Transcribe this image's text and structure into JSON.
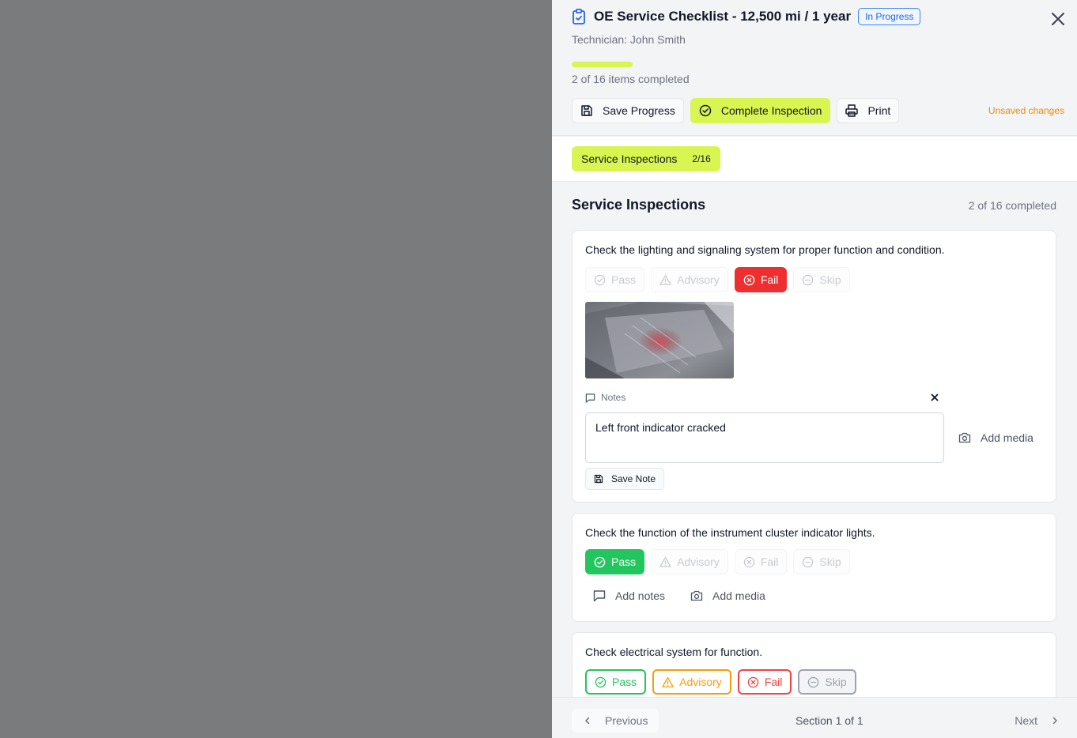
{
  "header": {
    "title": "OE Service Checklist - 12,500 mi / 1 year",
    "status_badge": "In Progress",
    "technician": "Technician: John Smith",
    "progress_text": "2 of 16 items completed",
    "progress_fraction": 0.125,
    "buttons": {
      "save": "Save Progress",
      "complete": "Complete Inspection",
      "print": "Print"
    },
    "unsaved": "Unsaved changes",
    "accent_color": "#d9f552"
  },
  "tabs": [
    {
      "label": "Service Inspections",
      "count": "2/16"
    }
  ],
  "section": {
    "title": "Service Inspections",
    "count": "2 of 16 completed"
  },
  "items": [
    {
      "question": "Check the lighting and signaling system for proper function and condition.",
      "options": [
        "Pass",
        "Advisory",
        "Fail",
        "Skip"
      ],
      "selected": "Fail",
      "notes_label": "Notes",
      "note_value": "Left front indicator cracked",
      "add_media": "Add media",
      "save_note": "Save Note"
    },
    {
      "question": "Check the function of the instrument cluster indicator lights.",
      "options": [
        "Pass",
        "Advisory",
        "Fail",
        "Skip"
      ],
      "selected": "Pass",
      "add_notes": "Add notes",
      "add_media": "Add media"
    },
    {
      "question": "Check electrical system for function.",
      "options": [
        "Pass",
        "Advisory",
        "Fail",
        "Skip"
      ],
      "selected": ""
    }
  ],
  "footer": {
    "previous": "Previous",
    "section_indicator": "Section 1 of 1",
    "next": "Next"
  },
  "colors": {
    "pass": "#22c55e",
    "advisory": "#f59e0b",
    "fail": "#ef4444",
    "skip": "#9ca3af",
    "unsaved": "#ea8a0c",
    "badge": "#2563eb"
  }
}
